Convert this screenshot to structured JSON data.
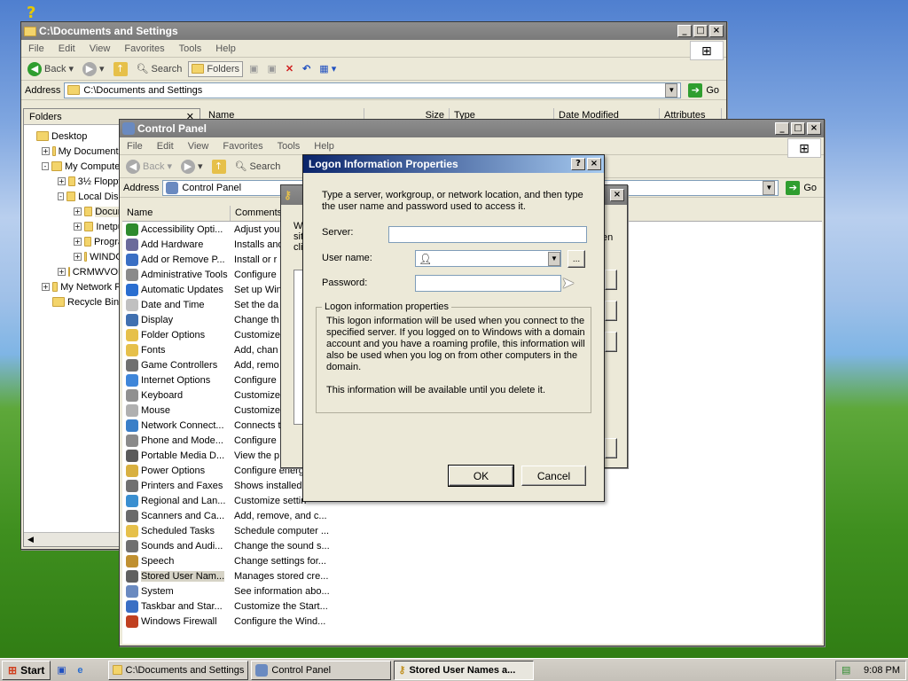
{
  "desktop": {
    "help_icon": "help-icon"
  },
  "win1": {
    "title": "C:\\Documents and Settings",
    "menu": [
      "File",
      "Edit",
      "View",
      "Favorites",
      "Tools",
      "Help"
    ],
    "toolbar": {
      "back": "Back",
      "search": "Search",
      "folders": "Folders"
    },
    "address_label": "Address",
    "address": "C:\\Documents and Settings",
    "go": "Go",
    "folders_title": "Folders",
    "columns": [
      "Name",
      "Size",
      "Type",
      "Date Modified",
      "Attributes"
    ],
    "tree": [
      {
        "label": "Desktop",
        "indent": 0,
        "exp": ""
      },
      {
        "label": "My Documents",
        "indent": 1,
        "exp": "+"
      },
      {
        "label": "My Computer",
        "indent": 1,
        "exp": "-"
      },
      {
        "label": "3½ Floppy",
        "indent": 2,
        "exp": "+"
      },
      {
        "label": "Local Disk",
        "indent": 2,
        "exp": "-"
      },
      {
        "label": "Docun",
        "indent": 3,
        "exp": "+"
      },
      {
        "label": "Inetpu",
        "indent": 3,
        "exp": "+"
      },
      {
        "label": "Progra",
        "indent": 3,
        "exp": "+"
      },
      {
        "label": "WINDO",
        "indent": 3,
        "exp": "+"
      },
      {
        "label": "CRMWVOL",
        "indent": 2,
        "exp": "+"
      },
      {
        "label": "My Network Pl",
        "indent": 1,
        "exp": "+"
      },
      {
        "label": "Recycle Bin",
        "indent": 1,
        "exp": ""
      }
    ]
  },
  "win2": {
    "title": "Control Panel",
    "menu": [
      "File",
      "Edit",
      "View",
      "Favorites",
      "Tools",
      "Help"
    ],
    "toolbar": {
      "back": "Back",
      "search": "Search"
    },
    "address_label": "Address",
    "address": "Control Panel",
    "go": "Go",
    "columns": [
      "Name",
      "Comments"
    ],
    "rows": [
      {
        "name": "Accessibility Opti...",
        "comment": "Adjust you",
        "color": "#2e8b2e"
      },
      {
        "name": "Add Hardware",
        "comment": "Installs and",
        "color": "#6b6b9b"
      },
      {
        "name": "Add or Remove P...",
        "comment": "Install or r",
        "color": "#3a6fc4"
      },
      {
        "name": "Administrative Tools",
        "comment": "Configure",
        "color": "#8a8a8a"
      },
      {
        "name": "Automatic Updates",
        "comment": "Set up Win",
        "color": "#2a6ed0"
      },
      {
        "name": "Date and Time",
        "comment": "Set the da",
        "color": "#c0c0c0"
      },
      {
        "name": "Display",
        "comment": "Change th",
        "color": "#4070b0"
      },
      {
        "name": "Folder Options",
        "comment": "Customize",
        "color": "#e6c04a"
      },
      {
        "name": "Fonts",
        "comment": "Add, chan",
        "color": "#e6c04a"
      },
      {
        "name": "Game Controllers",
        "comment": "Add, remo",
        "color": "#707070"
      },
      {
        "name": "Internet Options",
        "comment": "Configure",
        "color": "#3f86d9"
      },
      {
        "name": "Keyboard",
        "comment": "Customize",
        "color": "#909090"
      },
      {
        "name": "Mouse",
        "comment": "Customize",
        "color": "#b0b0b0"
      },
      {
        "name": "Network Connect...",
        "comment": "Connects t",
        "color": "#3a7fc8"
      },
      {
        "name": "Phone and Mode...",
        "comment": "Configure",
        "color": "#8a8a8a"
      },
      {
        "name": "Portable Media D...",
        "comment": "View the p",
        "color": "#5a5a5a"
      },
      {
        "name": "Power Options",
        "comment": "Configure energ",
        "color": "#d8b040"
      },
      {
        "name": "Printers and Faxes",
        "comment": "Shows installed p",
        "color": "#707070"
      },
      {
        "name": "Regional and Lan...",
        "comment": "Customize settin",
        "color": "#3a8fd0"
      },
      {
        "name": "Scanners and Ca...",
        "comment": "Add, remove, and c...",
        "color": "#6a6a6a"
      },
      {
        "name": "Scheduled Tasks",
        "comment": "Schedule computer ...",
        "color": "#e6c04a"
      },
      {
        "name": "Sounds and Audi...",
        "comment": "Change the sound s...",
        "color": "#707070"
      },
      {
        "name": "Speech",
        "comment": "Change settings for...",
        "color": "#c09030"
      },
      {
        "name": "Stored User Nam...",
        "comment": "Manages stored cre...",
        "color": "#606060"
      },
      {
        "name": "System",
        "comment": "See information abo...",
        "color": "#6a8ac0"
      },
      {
        "name": "Taskbar and Star...",
        "comment": "Customize the Start...",
        "color": "#3a6fc4"
      },
      {
        "name": "Windows Firewall",
        "comment": "Configure the Wind...",
        "color": "#c04020"
      }
    ]
  },
  "bgdialog": {
    "partial": [
      "W",
      "sit",
      "cli"
    ],
    "right_text": "en"
  },
  "dialog": {
    "title": "Logon Information Properties",
    "intro": "Type a server, workgroup, or network location, and then type the user name and password used to access it.",
    "server_label": "Server:",
    "server_value": "",
    "user_label": "User name:",
    "user_value": "",
    "browse": "...",
    "password_label": "Password:",
    "password_value": "",
    "group_title": "Logon information properties",
    "info1": "This logon information will be used when you connect to the specified server. If you logged on to Windows with a domain account and you have a roaming profile, this information will also be used when you log on from other computers in the domain.",
    "info2": "This information will be available until you delete it.",
    "ok": "OK",
    "cancel": "Cancel"
  },
  "taskbar": {
    "start": "Start",
    "tasks": [
      {
        "label": "C:\\Documents and Settings",
        "active": false
      },
      {
        "label": "Control Panel",
        "active": false
      },
      {
        "label": "Stored User Names a...",
        "active": true
      }
    ],
    "time": "9:08 PM"
  }
}
